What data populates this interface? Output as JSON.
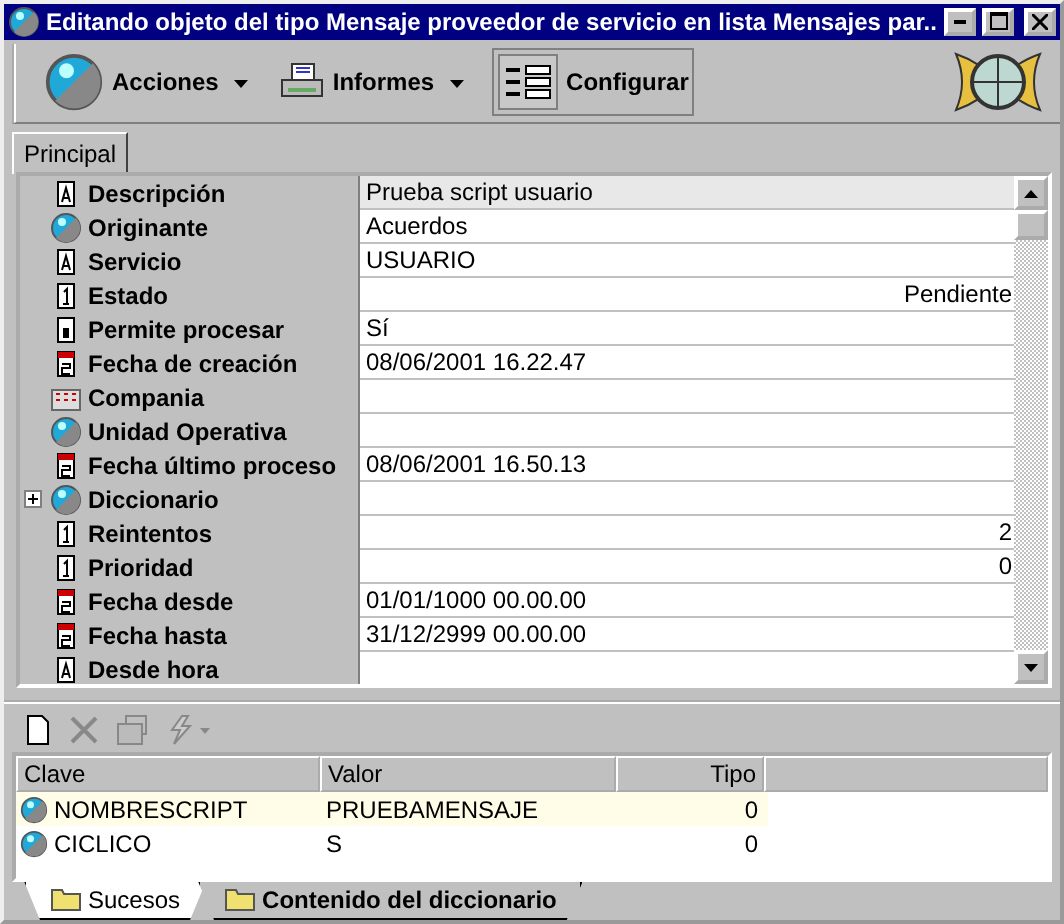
{
  "window": {
    "title": "Editando objeto del tipo Mensaje proveedor de servicio en lista Mensajes par..."
  },
  "toolbar": [
    {
      "label": "Acciones",
      "kind": "globe",
      "dropdown": true
    },
    {
      "label": "Informes",
      "kind": "printer",
      "dropdown": true
    },
    {
      "label": "Configurar",
      "kind": "layout",
      "dropdown": false
    }
  ],
  "tabs": [
    {
      "label": "Principal",
      "selected": true
    }
  ],
  "properties": [
    {
      "label": "Descripción",
      "kind": "text",
      "value": "Prueba script usuario",
      "selected": true
    },
    {
      "label": "Originante",
      "kind": "object",
      "value": "Acuerdos",
      "selected": false
    },
    {
      "label": "Servicio",
      "kind": "text",
      "value": "USUARIO",
      "selected": false
    },
    {
      "label": "Estado",
      "kind": "number",
      "value": "Pendiente",
      "selected": false
    },
    {
      "label": "Permite procesar",
      "kind": "bool",
      "value": "Sí",
      "selected": false
    },
    {
      "label": "Fecha de creación",
      "kind": "date",
      "value": "08/06/2001 16.22.47",
      "selected": false
    },
    {
      "label": "Compania",
      "kind": "company",
      "selected": false
    },
    {
      "label": "Unidad Operativa",
      "kind": "object",
      "selected": false
    },
    {
      "label": "Fecha último proceso",
      "kind": "date",
      "value": "08/06/2001 16.50.13",
      "selected": false
    },
    {
      "label": "Diccionario",
      "kind": "object",
      "expandable": true,
      "selected": false
    },
    {
      "label": "Reintentos",
      "kind": "number",
      "value": "2",
      "selected": false
    },
    {
      "label": "Prioridad",
      "kind": "number",
      "value": "0",
      "selected": false
    },
    {
      "label": "Fecha desde",
      "kind": "date",
      "value": "01/01/1000 00.00.00",
      "selected": false
    },
    {
      "label": "Fecha hasta",
      "kind": "date",
      "value": "31/12/2999 00.00.00",
      "selected": false
    },
    {
      "label": "Desde hora",
      "kind": "text",
      "selected": false
    }
  ],
  "list_toolbar": [
    {
      "kind": "new",
      "disabled": false
    },
    {
      "kind": "delete",
      "disabled": true
    },
    {
      "kind": "properties",
      "disabled": true
    },
    {
      "kind": "run",
      "disabled": true
    }
  ],
  "table": {
    "columns": [
      "Clave",
      "Valor",
      "Tipo"
    ],
    "rows": [
      {
        "cells": [
          "NOMBRESCRIPT",
          "PRUEBAMENSAJE",
          "0"
        ],
        "selected": true
      },
      {
        "cells": [
          "CICLICO",
          "S",
          "0"
        ],
        "selected": false
      }
    ]
  },
  "bottom_tabs": [
    {
      "label": "Sucesos",
      "selected": true
    },
    {
      "label": "Contenido del diccionario",
      "selected": false
    }
  ]
}
